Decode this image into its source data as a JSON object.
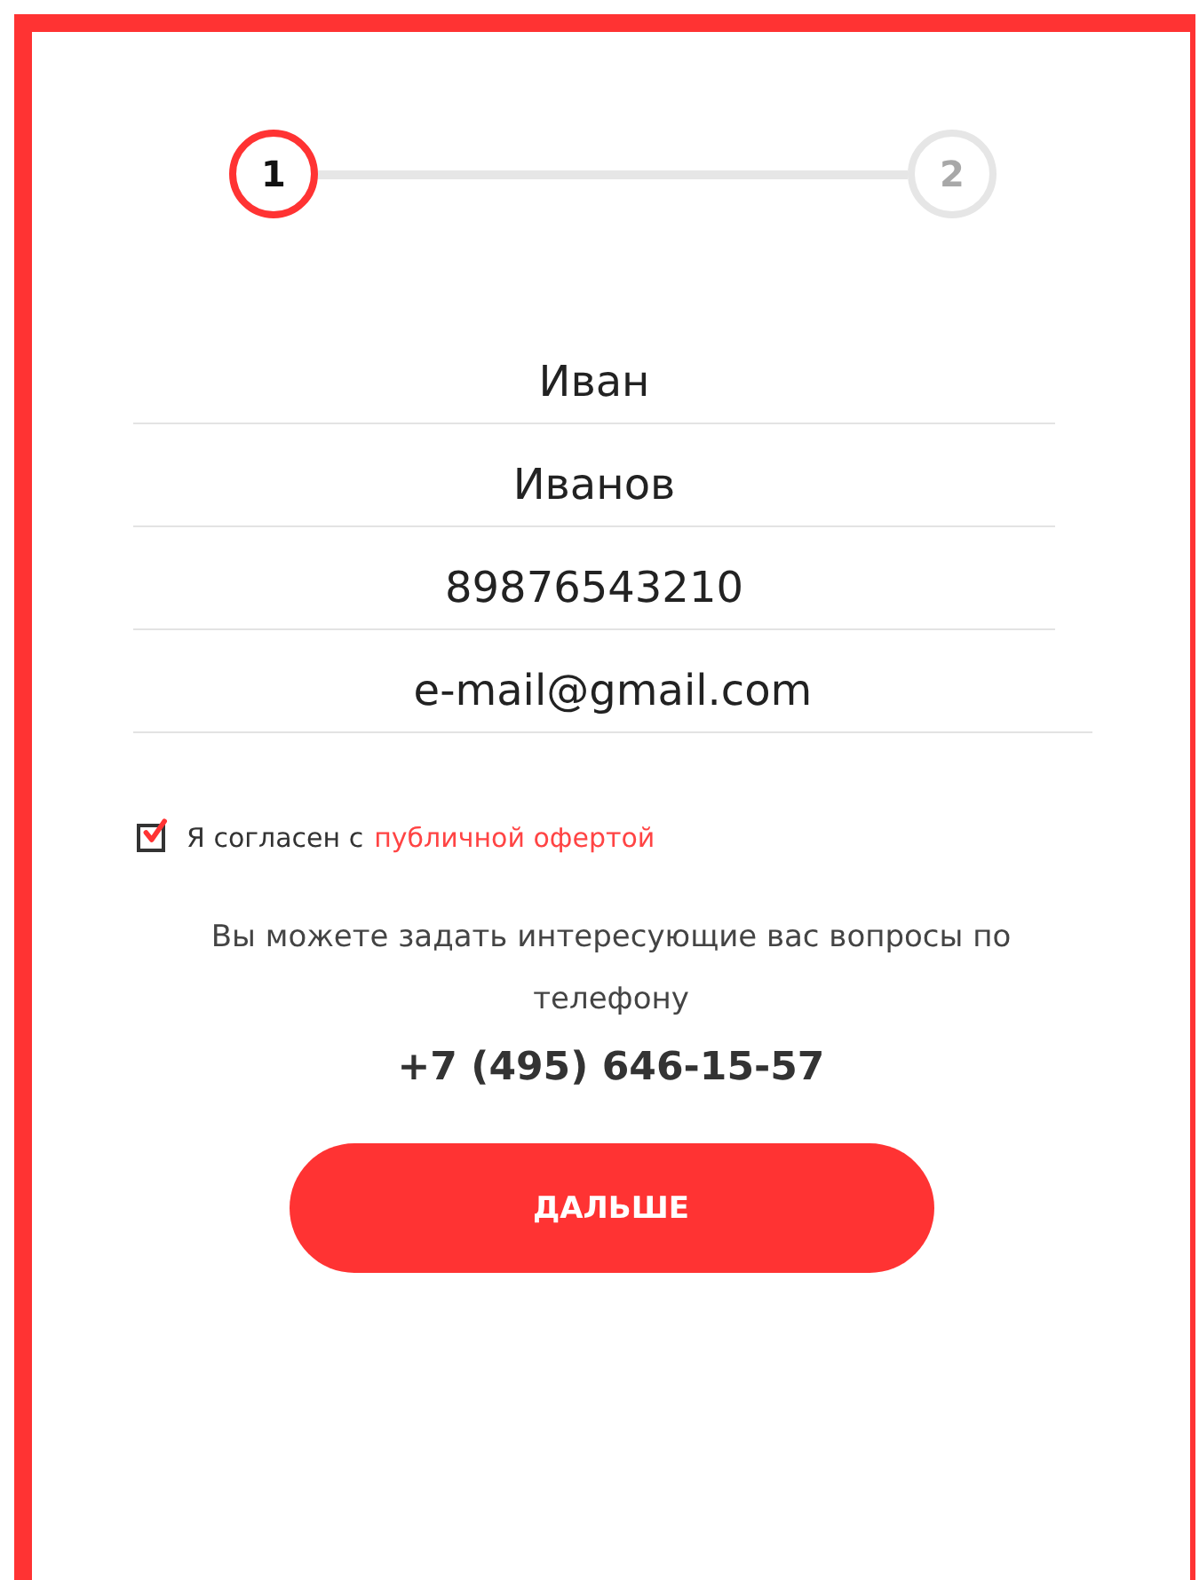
{
  "steps": [
    {
      "label": "1",
      "selected": true
    },
    {
      "label": "2",
      "selected": false
    }
  ],
  "fields": [
    {
      "value": "Иван"
    },
    {
      "value": "Иванов"
    },
    {
      "value": "89876543210"
    },
    {
      "value": "e-mail@gmail.com"
    }
  ],
  "agreement": {
    "checked": true,
    "text": "Я согласен с",
    "link": "публичной офертой"
  },
  "info": "Вы можете задать интересующие вас вопросы по телефону",
  "phone": "+7 (495) 646-15-57",
  "button": "ДАЛЬШЕ"
}
